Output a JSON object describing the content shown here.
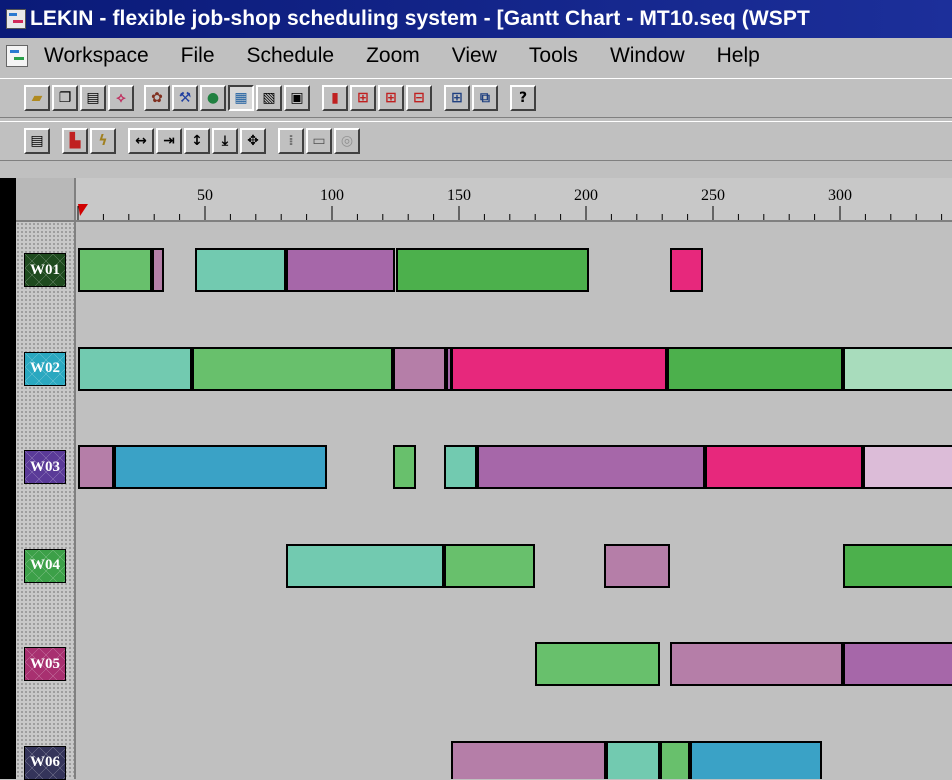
{
  "title": "LEKIN - flexible job-shop scheduling system - [Gantt Chart - MT10.seq (WSPT",
  "menu": [
    "Workspace",
    "File",
    "Schedule",
    "Zoom",
    "View",
    "Tools",
    "Window",
    "Help"
  ],
  "ruler": {
    "ticks": [
      "50",
      "100",
      "150",
      "200",
      "250",
      "300"
    ]
  },
  "colors": {
    "job_green": "#68c06c",
    "job_teal": "#72cab0",
    "job_purple": "#a667a9",
    "job_mauve": "#b57ea8",
    "job_darkgreen": "#4cb04c",
    "job_pink": "#e7287c",
    "job_blue": "#3aa2c6",
    "job_mint": "#a8dcbc",
    "job_lilac": "#dcbcd8"
  },
  "workcenters": [
    {
      "label": "W01",
      "color": "#1e4a1e",
      "ops": [
        {
          "start": 0,
          "end": 29,
          "color": "#68c06c"
        },
        {
          "start": 29,
          "end": 34,
          "color": "#b57ea8"
        },
        {
          "start": 46,
          "end": 82,
          "color": "#72cab0"
        },
        {
          "start": 82,
          "end": 125,
          "color": "#a667a9"
        },
        {
          "start": 125,
          "end": 201,
          "color": "#4cb04c"
        },
        {
          "start": 233,
          "end": 246,
          "color": "#e7287c"
        }
      ]
    },
    {
      "label": "W02",
      "color": "#2aa8c0",
      "ops": [
        {
          "start": 0,
          "end": 45,
          "color": "#72cab0"
        },
        {
          "start": 45,
          "end": 124,
          "color": "#68c06c"
        },
        {
          "start": 124,
          "end": 145,
          "color": "#b57ea8"
        },
        {
          "start": 145,
          "end": 147,
          "color": "#a667a9"
        },
        {
          "start": 147,
          "end": 232,
          "color": "#e7287c"
        },
        {
          "start": 232,
          "end": 301,
          "color": "#4cb04c"
        },
        {
          "start": 301,
          "end": 345,
          "color": "#a8dcbc"
        }
      ]
    },
    {
      "label": "W03",
      "color": "#5a3a98",
      "ops": [
        {
          "start": 0,
          "end": 14,
          "color": "#b57ea8"
        },
        {
          "start": 14,
          "end": 98,
          "color": "#3aa2c6"
        },
        {
          "start": 124,
          "end": 133,
          "color": "#68c06c"
        },
        {
          "start": 144,
          "end": 157,
          "color": "#72cab0"
        },
        {
          "start": 157,
          "end": 247,
          "color": "#a667a9"
        },
        {
          "start": 247,
          "end": 309,
          "color": "#e7287c"
        },
        {
          "start": 309,
          "end": 345,
          "color": "#dcbcd8"
        }
      ]
    },
    {
      "label": "W04",
      "color": "#3ca048",
      "ops": [
        {
          "start": 82,
          "end": 144,
          "color": "#72cab0"
        },
        {
          "start": 144,
          "end": 180,
          "color": "#68c06c"
        },
        {
          "start": 207,
          "end": 233,
          "color": "#b57ea8"
        },
        {
          "start": 301,
          "end": 345,
          "color": "#4cb04c"
        }
      ]
    },
    {
      "label": "W05",
      "color": "#a83070",
      "ops": [
        {
          "start": 180,
          "end": 229,
          "color": "#68c06c"
        },
        {
          "start": 233,
          "end": 301,
          "color": "#b57ea8"
        },
        {
          "start": 301,
          "end": 345,
          "color": "#a667a9"
        }
      ]
    },
    {
      "label": "W06",
      "color": "#34345a",
      "ops": [
        {
          "start": 147,
          "end": 208,
          "color": "#b57ea8"
        },
        {
          "start": 208,
          "end": 229,
          "color": "#72cab0"
        },
        {
          "start": 229,
          "end": 241,
          "color": "#68c06c"
        },
        {
          "start": 241,
          "end": 293,
          "color": "#3aa2c6"
        }
      ]
    }
  ]
}
